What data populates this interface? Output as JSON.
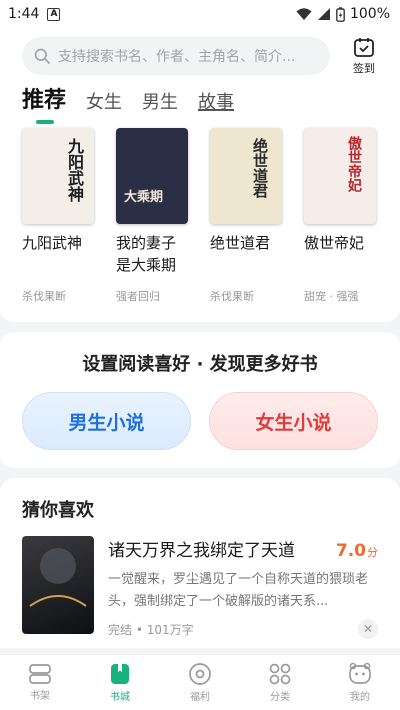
{
  "status": {
    "time": "1:44",
    "notif": "A",
    "battery": "100%"
  },
  "search": {
    "placeholder": "支持搜索书名、作者、主角名、简介..."
  },
  "checkin": {
    "label": "签到"
  },
  "tabs": [
    {
      "label": "推荐"
    },
    {
      "label": "女生"
    },
    {
      "label": "男生"
    },
    {
      "label": "故事"
    }
  ],
  "recommend": [
    {
      "title": "九阳武神",
      "tag": "杀伐果断",
      "cover_text": "九阳武神",
      "cover_bg": "#f3efe8",
      "cover_fg": "#1c1c1c"
    },
    {
      "title": "我的妻子是大乘期",
      "tag": "强者回归",
      "cover_text": "大乘期",
      "cover_bg": "#2a2f45",
      "cover_fg": "#f4e9d6"
    },
    {
      "title": "绝世道君",
      "tag": "杀伐果断",
      "cover_text": "绝世道君",
      "cover_bg": "#efe6cf",
      "cover_fg": "#2a2a2a"
    },
    {
      "title": "傲世帝妃",
      "tag": "甜宠 · 强强",
      "cover_text": "傲世帝妃",
      "cover_bg": "#f6ecea",
      "cover_fg": "#b3282d"
    }
  ],
  "preference": {
    "title": "设置阅读喜好 · 发现更多好书",
    "male": "男生小说",
    "female": "女生小说"
  },
  "guess": {
    "title": "猜你喜欢",
    "item": {
      "name": "诸天万界之我绑定了天道",
      "score": "7.0",
      "score_unit": "分",
      "desc": "一觉醒来，罗尘遇见了一个自称天道的猥琐老头，强制绑定了一个破解版的诸天系...",
      "meta": "完结 • 101万字",
      "cover_text": "诸天万界之我绑定了天道"
    }
  },
  "nav": [
    {
      "label": "书架",
      "icon": "bookshelf-icon"
    },
    {
      "label": "书城",
      "icon": "bookstore-icon"
    },
    {
      "label": "福利",
      "icon": "welfare-icon"
    },
    {
      "label": "分类",
      "icon": "category-icon"
    },
    {
      "label": "我的",
      "icon": "profile-icon"
    }
  ],
  "colors": {
    "accent": "#19b27d",
    "score": "#f06a2b",
    "male": "#1f6fe0",
    "female": "#e23a3a"
  }
}
